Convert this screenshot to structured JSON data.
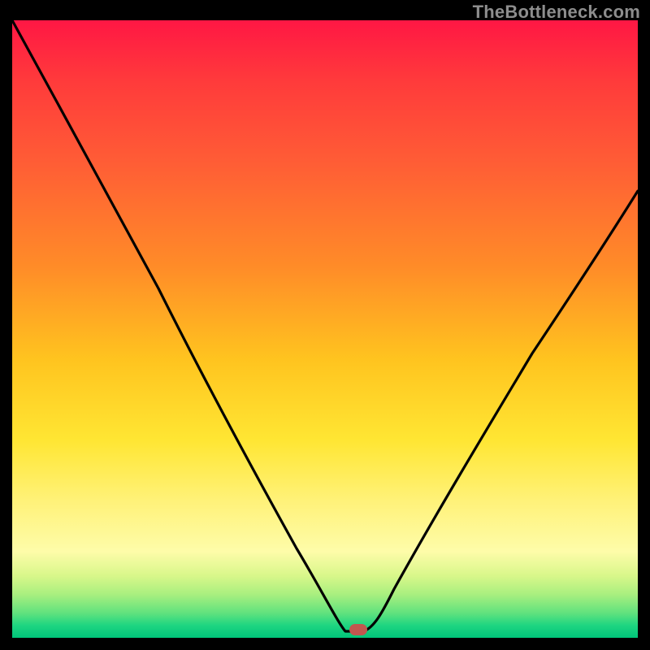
{
  "watermark": "TheBottleneck.com",
  "chart_data": {
    "type": "line",
    "title": "",
    "xlabel": "",
    "ylabel": "",
    "xlim": [
      0,
      100
    ],
    "ylim": [
      0,
      100
    ],
    "grid": false,
    "legend": false,
    "series": [
      {
        "name": "bottleneck-curve",
        "x": [
          0,
          5,
          10,
          20,
          30,
          40,
          48,
          52,
          53,
          55,
          57,
          60,
          70,
          80,
          90,
          100
        ],
        "values": [
          100,
          90,
          80,
          62,
          46,
          30,
          15,
          3,
          1,
          0,
          1,
          4,
          20,
          35,
          50,
          62
        ]
      }
    ],
    "annotations": [
      {
        "name": "min-marker",
        "x": 55,
        "y": 0
      }
    ],
    "colors": {
      "curve": "#000000",
      "marker": "#c1574f",
      "gradient_top": "#ff1744",
      "gradient_bottom": "#00c47a"
    }
  }
}
